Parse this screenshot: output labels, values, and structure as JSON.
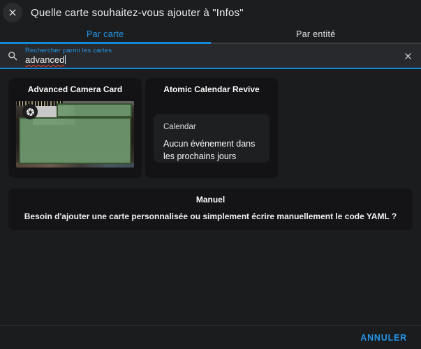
{
  "accent_color": "#2496e8",
  "accent_underline_color": "#1588d6",
  "header": {
    "title": "Quelle carte souhaitez-vous ajouter à \"Infos\""
  },
  "tabs": [
    {
      "label": "Par carte",
      "active": true
    },
    {
      "label": "Par entité",
      "active": false
    }
  ],
  "search": {
    "label": "Rechercher parmi les cartes",
    "value": "advanced",
    "search_icon": "magnifier-icon",
    "clear_icon": "close-icon",
    "spellcheck_underline_color": "#e5443d"
  },
  "cards": [
    {
      "title": "Advanced Camera Card",
      "preview": "camera snapshot with green detection boxes, shutter badge and timestamp overlay",
      "detection_box_fill": "#6e986e",
      "detection_box_border": "#37532f"
    },
    {
      "title": "Atomic Calendar Revive",
      "calendar_title": "Calendar",
      "calendar_message": "Aucun événement dans les prochains jours"
    }
  ],
  "manual_card": {
    "title": "Manuel",
    "description": "Besoin d'ajouter une carte personnalisée ou simplement écrire manuellement le code YAML ?"
  },
  "footer": {
    "cancel_label": "ANNULER"
  }
}
